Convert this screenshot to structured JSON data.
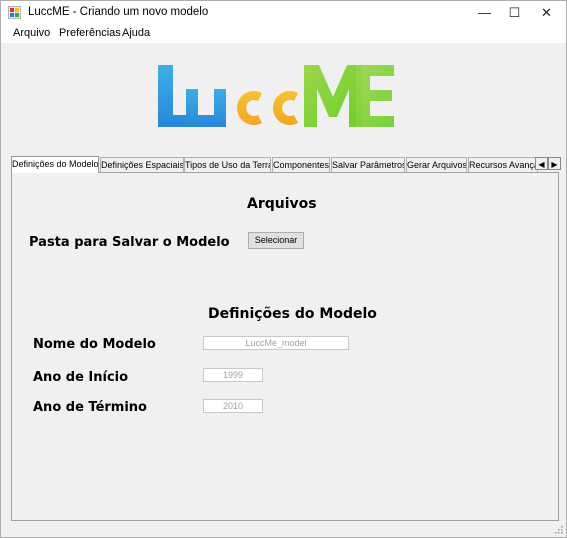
{
  "window": {
    "title": "LuccME - Criando um novo modelo",
    "minimize_glyph": "—",
    "maximize_glyph": "☐",
    "close_glyph": "✕"
  },
  "menu": {
    "items": [
      "Arquivo",
      "Preferências",
      "Ajuda"
    ]
  },
  "logo": {
    "text": "LuccME",
    "colors": [
      "#2a86d8",
      "#3ab0e6",
      "#f2a623",
      "#f7c233",
      "#6ccf2a",
      "#9bd64c"
    ]
  },
  "tabs": {
    "items": [
      "Definições do Modelo",
      "Definições Espaciais",
      "Tipos de Uso da Terra",
      "Componentes",
      "Salvar Parâmetros",
      "Gerar Arquivos",
      "Recursos Avança"
    ],
    "active_index": 0,
    "scroll_left": "◀",
    "scroll_right": "▶"
  },
  "panel": {
    "files_section": {
      "title": "Arquivos",
      "folder_label": "Pasta para Salvar o Modelo",
      "select_button": "Selecionar"
    },
    "model_section": {
      "title": "Definições do Modelo",
      "name_label": "Nome do Modelo",
      "name_value": "LuccMe_model",
      "start_label": "Ano de Início",
      "start_value": "1999",
      "end_label": "Ano de Término",
      "end_value": "2010"
    }
  }
}
